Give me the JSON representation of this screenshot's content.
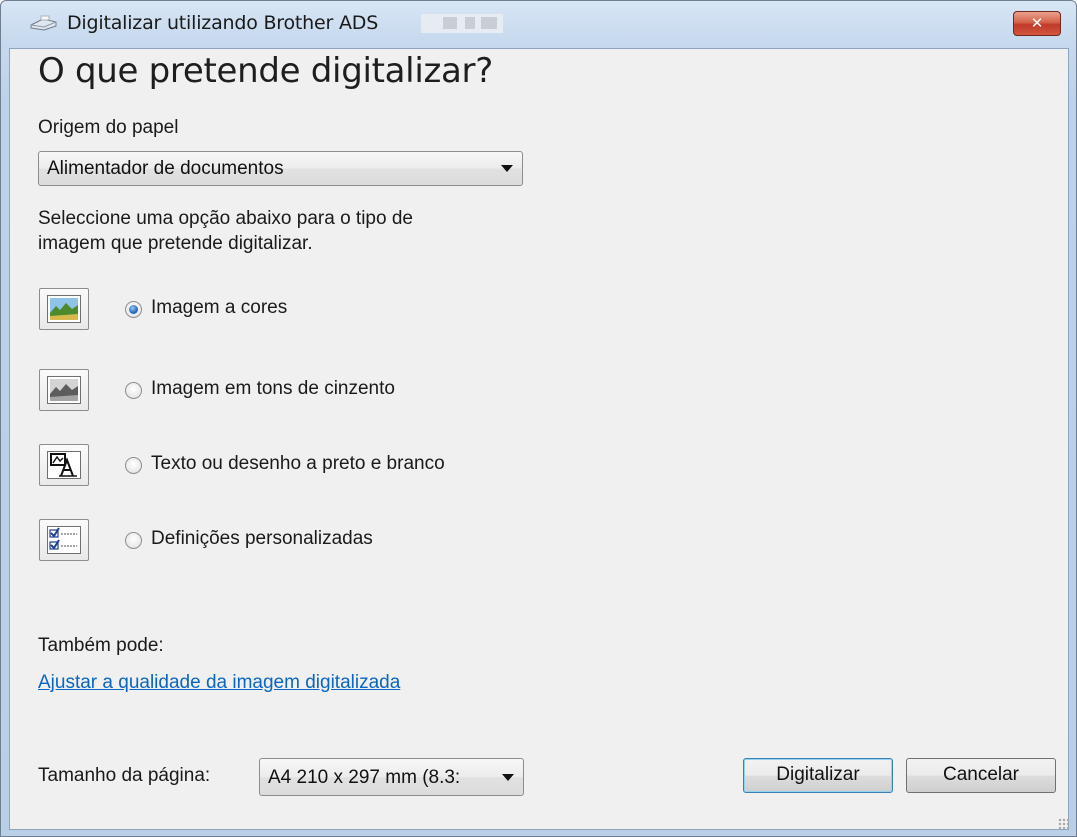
{
  "window": {
    "title": "Digitalizar utilizando Brother ADS",
    "close_label": "✕"
  },
  "heading": "O que pretende digitalizar?",
  "paper_source": {
    "label": "Origem do papel",
    "selected": "Alimentador de documentos"
  },
  "instructions": {
    "line1": "Seleccione uma opção abaixo para o tipo de",
    "line2": "imagem que pretende digitalizar."
  },
  "options": [
    {
      "label": "Imagem a cores",
      "icon": "color-picture-icon",
      "selected": true
    },
    {
      "label": "Imagem em tons de cinzento",
      "icon": "grayscale-picture-icon",
      "selected": false
    },
    {
      "label": "Texto ou desenho a preto e branco",
      "icon": "text-drawing-icon",
      "selected": false
    },
    {
      "label": "Definições personalizadas",
      "icon": "custom-settings-icon",
      "selected": false
    }
  ],
  "also": {
    "label": "Também pode:",
    "link": "Ajustar a qualidade da imagem digitalizada"
  },
  "page_size": {
    "label": "Tamanho da página:",
    "selected": "A4 210 x 297 mm (8.3:"
  },
  "buttons": {
    "scan": "Digitalizar",
    "cancel": "Cancelar"
  },
  "colors": {
    "link": "#0a66c2",
    "close": "#c0392b",
    "client_bg": "#f0f0f0"
  }
}
